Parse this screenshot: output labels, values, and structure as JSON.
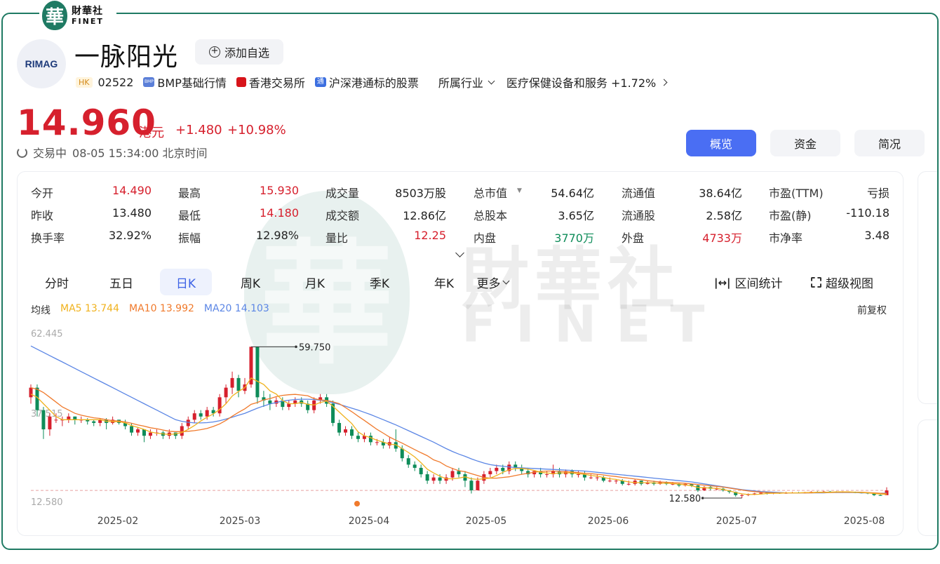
{
  "brand": {
    "cn": "財華社",
    "en": "FINET",
    "seal": "華"
  },
  "header": {
    "logo_text": "RIMAG",
    "stock_name": "一脉阳光",
    "add_watch_label": "添加自选",
    "market_tag": "HK",
    "code": "02522",
    "bmp_label": "BMP基础行情",
    "exchange": "香港交易所",
    "connect_label": "沪深港通标的股票",
    "industry_label": "所属行业",
    "industry_value": "医疗保健设备和服务 +1.72%"
  },
  "quote": {
    "price": "14.960",
    "unit": "港元",
    "change": "+1.480",
    "change_pct": "+10.98%",
    "status": "交易中",
    "time": "08-05 15:34:00 北京时间"
  },
  "tabs": [
    {
      "label": "概览",
      "active": true
    },
    {
      "label": "资金",
      "active": false
    },
    {
      "label": "简况",
      "active": false
    }
  ],
  "stats": [
    [
      {
        "label": "今开",
        "value": "14.490",
        "tone": "up"
      },
      {
        "label": "最高",
        "value": "15.930",
        "tone": "up"
      },
      {
        "label": "成交量",
        "value": "8503万股",
        "tone": ""
      },
      {
        "label": "总市值",
        "value": "54.64亿",
        "tone": "",
        "dropdown": true
      },
      {
        "label": "流通值",
        "value": "38.64亿",
        "tone": ""
      },
      {
        "label": "市盈(TTM)",
        "value": "亏损",
        "tone": ""
      }
    ],
    [
      {
        "label": "昨收",
        "value": "13.480",
        "tone": ""
      },
      {
        "label": "最低",
        "value": "14.180",
        "tone": "up"
      },
      {
        "label": "成交额",
        "value": "12.86亿",
        "tone": ""
      },
      {
        "label": "总股本",
        "value": "3.65亿",
        "tone": ""
      },
      {
        "label": "流通股",
        "value": "2.58亿",
        "tone": ""
      },
      {
        "label": "市盈(静)",
        "value": "-110.18",
        "tone": ""
      }
    ],
    [
      {
        "label": "换手率",
        "value": "32.92%",
        "tone": ""
      },
      {
        "label": "振幅",
        "value": "12.98%",
        "tone": ""
      },
      {
        "label": "量比",
        "value": "12.25",
        "tone": "up"
      },
      {
        "label": "内盘",
        "value": "3770万",
        "tone": "down"
      },
      {
        "label": "外盘",
        "value": "4733万",
        "tone": "up"
      },
      {
        "label": "市净率",
        "value": "3.48",
        "tone": ""
      }
    ]
  ],
  "period_tabs": [
    {
      "label": "分时",
      "active": false
    },
    {
      "label": "五日",
      "active": false
    },
    {
      "label": "日K",
      "active": true
    },
    {
      "label": "周K",
      "active": false
    },
    {
      "label": "月K",
      "active": false
    },
    {
      "label": "季K",
      "active": false
    },
    {
      "label": "年K",
      "active": false
    },
    {
      "label": "更多",
      "active": false
    }
  ],
  "tools": {
    "range_label": "区间统计",
    "super_view_label": "超级视图"
  },
  "legend": {
    "title": "均线",
    "ma5": "MA5 13.744",
    "ma10": "MA10 13.992",
    "ma20": "MA20 14.103",
    "adjust": "前复权"
  },
  "colors": {
    "up": "#d6202d",
    "down": "#0e8c59",
    "accent": "#4a6ef3",
    "ma5": "#f0b21e",
    "ma10": "#f07a2c",
    "ma20": "#5b86e5",
    "brand": "#1f7a63"
  },
  "chart_data": {
    "type": "candlestick",
    "y_ticks": [
      "62.445",
      "37.515",
      "12.580"
    ],
    "x_ticks": [
      "2025-02",
      "2025-03",
      "2025-04",
      "2025-05",
      "2025-06",
      "2025-07",
      "2025-08"
    ],
    "annotations": {
      "high": "59.750",
      "low": "12.580"
    },
    "ylim": [
      12.58,
      62.445
    ],
    "candles": [
      [
        44,
        47,
        42,
        48
      ],
      [
        47,
        40,
        38,
        48
      ],
      [
        40,
        34,
        31,
        41
      ],
      [
        34,
        38,
        32,
        39
      ],
      [
        37,
        37,
        36,
        39
      ],
      [
        37,
        37,
        35,
        38
      ],
      [
        37,
        38,
        36,
        39
      ],
      [
        38,
        37,
        35.5,
        38
      ],
      [
        37,
        37,
        36,
        38
      ],
      [
        37,
        36.5,
        35.5,
        37.5
      ],
      [
        36.5,
        36,
        35,
        37
      ],
      [
        36,
        37,
        35,
        37.5
      ],
      [
        37,
        36,
        34,
        37.5
      ],
      [
        36,
        37,
        35.5,
        38
      ],
      [
        37,
        36,
        35.5,
        37
      ],
      [
        36,
        35,
        34,
        37
      ],
      [
        35,
        33,
        32,
        36
      ],
      [
        33,
        34,
        32,
        34.5
      ],
      [
        34,
        32,
        30,
        34
      ],
      [
        32,
        33,
        31,
        34
      ],
      [
        33,
        33,
        32,
        34
      ],
      [
        33,
        32,
        31,
        33.5
      ],
      [
        32,
        33,
        31,
        34
      ],
      [
        33,
        32,
        31,
        33
      ],
      [
        32,
        35,
        31,
        36
      ],
      [
        35,
        37,
        34,
        38
      ],
      [
        37,
        39,
        36,
        40
      ],
      [
        39,
        38,
        37,
        40
      ],
      [
        38,
        40,
        37,
        41
      ],
      [
        40,
        39,
        38,
        41
      ],
      [
        39,
        44,
        38,
        45
      ],
      [
        44,
        47,
        42,
        48
      ],
      [
        47,
        50,
        45,
        52
      ],
      [
        50,
        46,
        44,
        51
      ],
      [
        46,
        48,
        45,
        50
      ],
      [
        48,
        59.75,
        47,
        59.75
      ],
      [
        59.75,
        44,
        42,
        59.75
      ],
      [
        44,
        43,
        41,
        46
      ],
      [
        43,
        42,
        40,
        45
      ],
      [
        42,
        43,
        41,
        44
      ],
      [
        43,
        41,
        40,
        44
      ],
      [
        41,
        42,
        40,
        43
      ],
      [
        42,
        43,
        41,
        44
      ],
      [
        43,
        42,
        41,
        44
      ],
      [
        42,
        40,
        39,
        43
      ],
      [
        40,
        43,
        39,
        44
      ],
      [
        43,
        44,
        42,
        45
      ],
      [
        44,
        42,
        41,
        45
      ],
      [
        42,
        36,
        35,
        43
      ],
      [
        36,
        33,
        32,
        37
      ],
      [
        33,
        34,
        32,
        35
      ],
      [
        34,
        32,
        31,
        35
      ],
      [
        32,
        31,
        30,
        33
      ],
      [
        31,
        32,
        30,
        33
      ],
      [
        32,
        30,
        29,
        33
      ],
      [
        30,
        30,
        29,
        31
      ],
      [
        30,
        29,
        28,
        31
      ],
      [
        29,
        30,
        28,
        31.5
      ],
      [
        30,
        28,
        27,
        34
      ],
      [
        28,
        25,
        24,
        29
      ],
      [
        25,
        23,
        22,
        26
      ],
      [
        23,
        22,
        21,
        24
      ],
      [
        22,
        20,
        19,
        23
      ],
      [
        20,
        18,
        17,
        21
      ],
      [
        18,
        19,
        17,
        20
      ],
      [
        19,
        18,
        17,
        20
      ],
      [
        18,
        19,
        17,
        20
      ],
      [
        19,
        21,
        18,
        22
      ],
      [
        21,
        20,
        19,
        22
      ],
      [
        20,
        18,
        16,
        21
      ],
      [
        18,
        15,
        14,
        19
      ],
      [
        15,
        18,
        15,
        19
      ],
      [
        18,
        20,
        17,
        21
      ],
      [
        20,
        21,
        19,
        22
      ],
      [
        21,
        22,
        20,
        23
      ],
      [
        22,
        21,
        20,
        23
      ],
      [
        21,
        23,
        20,
        24
      ],
      [
        23,
        22,
        21,
        24
      ],
      [
        22,
        21,
        20,
        23
      ],
      [
        21,
        20,
        19,
        22
      ],
      [
        20,
        21,
        19,
        21
      ],
      [
        21,
        20,
        19,
        22
      ],
      [
        20,
        20,
        19,
        21
      ],
      [
        20,
        21,
        19,
        23
      ],
      [
        21,
        20,
        19,
        22
      ],
      [
        20,
        21,
        19,
        21.5
      ],
      [
        21,
        20,
        19,
        21.5
      ],
      [
        20,
        20,
        19,
        21
      ],
      [
        20,
        19,
        18,
        21
      ],
      [
        19,
        19,
        18.5,
        20
      ],
      [
        19,
        19,
        18,
        20
      ],
      [
        19,
        18,
        17.5,
        19.5
      ],
      [
        18,
        18,
        17.5,
        19
      ],
      [
        18,
        18,
        17,
        18.5
      ],
      [
        18,
        17,
        16.5,
        18.5
      ],
      [
        17,
        17,
        16.5,
        18
      ],
      [
        17,
        18,
        16.5,
        18.5
      ],
      [
        18,
        17,
        16.5,
        18
      ],
      [
        17,
        17.5,
        16.8,
        18
      ],
      [
        17.5,
        17,
        16.5,
        18
      ],
      [
        17,
        17.5,
        16.7,
        18
      ],
      [
        17.5,
        17,
        16.6,
        17.8
      ],
      [
        17,
        17,
        16.6,
        17.6
      ],
      [
        17,
        16.5,
        16,
        17.3
      ],
      [
        16.5,
        17,
        16.2,
        17.2
      ],
      [
        17,
        16.5,
        16,
        17
      ],
      [
        16.5,
        15,
        14.5,
        16.8
      ],
      [
        15,
        16,
        14.8,
        16.3
      ],
      [
        16,
        15.5,
        15,
        16.3
      ],
      [
        15.5,
        15.5,
        15,
        16
      ],
      [
        15.5,
        15,
        14.6,
        15.8
      ],
      [
        15,
        14.5,
        14,
        15
      ],
      [
        14.5,
        13.5,
        13,
        14.6
      ],
      [
        13.5,
        13.5,
        12.58,
        14
      ],
      [
        13.5,
        13.8,
        13.2,
        14
      ],
      [
        13.8,
        14,
        13.5,
        14.2
      ],
      [
        14,
        14.2,
        13.8,
        14.4
      ],
      [
        14.2,
        14,
        13.7,
        14.4
      ],
      [
        14,
        14.2,
        13.8,
        14.4
      ],
      [
        14.2,
        14.1,
        13.9,
        14.4
      ],
      [
        14.1,
        14.2,
        13.9,
        14.5
      ],
      [
        14.2,
        14.3,
        14,
        14.5
      ],
      [
        14.3,
        14.2,
        14,
        14.5
      ],
      [
        14.2,
        14.3,
        14,
        14.5
      ],
      [
        14.3,
        14.5,
        14.1,
        14.7
      ],
      [
        14.5,
        14.4,
        14.2,
        14.7
      ],
      [
        14.4,
        14.6,
        14.2,
        14.8
      ],
      [
        14.6,
        14.5,
        14.3,
        14.8
      ],
      [
        14.5,
        14.4,
        14.2,
        14.7
      ],
      [
        14.4,
        14.5,
        14.2,
        14.7
      ],
      [
        14.5,
        14.4,
        14.2,
        14.6
      ],
      [
        14.4,
        14.3,
        14.1,
        14.6
      ],
      [
        14.3,
        14.2,
        14,
        14.5
      ],
      [
        14.2,
        14,
        13.8,
        14.4
      ],
      [
        14,
        13.5,
        13.2,
        14.2
      ],
      [
        13.5,
        13.48,
        13.3,
        13.8
      ],
      [
        13.48,
        14.96,
        14.18,
        15.93
      ]
    ],
    "ma5": [
      45,
      44,
      42,
      40,
      38,
      37,
      37,
      37,
      37,
      37,
      37,
      37,
      36.5,
      36.4,
      36.4,
      36,
      35.2,
      34.6,
      34,
      33.2,
      32.8,
      32.6,
      32.4,
      32.6,
      33,
      34,
      35.2,
      36.6,
      37.8,
      38.8,
      40.2,
      42,
      44.4,
      45.8,
      47,
      50,
      49,
      48,
      46,
      45,
      43,
      42,
      42,
      42.4,
      41.8,
      41.6,
      42.4,
      42.8,
      41.2,
      39.4,
      37.6,
      35.8,
      33.2,
      32,
      31.4,
      30.6,
      30,
      29.4,
      29.2,
      28,
      26.8,
      25.4,
      23.6,
      21.6,
      20.4,
      19.4,
      18.6,
      18.6,
      18.8,
      19.2,
      18.6,
      18.4,
      18.6,
      18.8,
      19.6,
      20.6,
      21.4,
      21.8,
      21.8,
      21.6,
      21.2,
      20.6,
      20.4,
      20.2,
      20.4,
      20.4,
      20.4,
      20.2,
      20,
      19.6,
      19.4,
      19,
      18.6,
      18.4,
      18,
      17.6,
      17.4,
      17.4,
      17.4,
      17.3,
      17.2,
      17.2,
      17.1,
      16.9,
      16.7,
      16.4,
      15.9,
      15.8,
      15.7,
      15.6,
      15.3,
      14.8,
      14.3,
      13.9,
      13.7,
      13.7,
      13.8,
      14,
      14.1,
      14.1,
      14.2,
      14.2,
      14.2,
      14.3,
      14.3,
      14.4,
      14.4,
      14.4,
      14.5,
      14.5,
      14.5,
      14.4,
      14.3,
      14.2,
      14,
      13.8,
      13.74
    ],
    "ma10": [
      47,
      46.5,
      45.5,
      44,
      42.5,
      41,
      40,
      39,
      38.4,
      38,
      37.6,
      37.4,
      37,
      36.7,
      36.6,
      36.3,
      35.9,
      35.4,
      35,
      34.5,
      34.2,
      33.8,
      33.4,
      33.3,
      33.3,
      33.4,
      33.6,
      33.9,
      34.3,
      34.9,
      35.7,
      36.8,
      38.1,
      39.3,
      40.4,
      41.8,
      42.4,
      43.2,
      43.6,
      44.2,
      44.6,
      44.8,
      44.9,
      44.7,
      44.5,
      43.6,
      43.2,
      43,
      42.6,
      42,
      40.8,
      39.5,
      38.1,
      36.8,
      35.4,
      34,
      32.8,
      31.6,
      30.6,
      29.7,
      28.7,
      27.7,
      26.7,
      25.8,
      24.5,
      23.8,
      22.6,
      21.8,
      21.1,
      20.8,
      20.2,
      19.6,
      19,
      18.8,
      18.8,
      19,
      19.2,
      19.6,
      20,
      20.3,
      20.6,
      20.9,
      21,
      21,
      20.9,
      20.8,
      20.7,
      20.5,
      20.3,
      20.2,
      20,
      19.8,
      19.5,
      19.3,
      19,
      18.8,
      18.5,
      18.3,
      18,
      17.8,
      17.6,
      17.5,
      17.4,
      17.3,
      17.2,
      17,
      16.8,
      16.6,
      16.4,
      16.2,
      16,
      15.7,
      15.4,
      15.1,
      14.8,
      14.6,
      14.4,
      14.3,
      14.2,
      14.2,
      14.2,
      14.2,
      14.2,
      14.2,
      14.2,
      14.3,
      14.3,
      14.3,
      14.4,
      14.4,
      14.4,
      14.4,
      14.4,
      14.3,
      14.2,
      14.1,
      13.99
    ],
    "ma20": [
      60,
      59,
      58,
      57,
      56,
      55,
      54,
      53,
      52,
      51,
      50,
      49,
      48,
      47,
      46,
      45,
      44,
      43,
      42,
      41,
      40,
      39,
      38,
      37,
      36.5,
      36.2,
      36,
      36,
      36.1,
      36.3,
      36.7,
      37.2,
      37.8,
      38.4,
      39,
      39.8,
      40.6,
      41.3,
      41.9,
      42.4,
      42.8,
      43.1,
      43.3,
      43.4,
      43.4,
      43.3,
      43.1,
      42.8,
      42.3,
      41.8,
      41.2,
      40.6,
      40,
      39.3,
      38.6,
      37.8,
      37,
      36.2,
      35.4,
      34.5,
      33.6,
      32.7,
      31.8,
      30.9,
      30,
      29,
      28,
      27.1,
      26.3,
      25.6,
      24.8,
      24.1,
      23.5,
      23,
      22.7,
      22.5,
      22.3,
      22.1,
      22,
      21.9,
      21.8,
      21.7,
      21.6,
      21.5,
      21.4,
      21.3,
      21.2,
      21.1,
      21,
      20.8,
      20.6,
      20.4,
      20.2,
      20,
      19.8,
      19.6,
      19.4,
      19.2,
      19,
      18.8,
      18.6,
      18.4,
      18.2,
      18,
      17.8,
      17.6,
      17.3,
      17,
      16.7,
      16.4,
      16.1,
      15.8,
      15.5,
      15.2,
      15,
      14.8,
      14.6,
      14.5,
      14.4,
      14.3,
      14.2,
      14.2,
      14.2,
      14.2,
      14.2,
      14.2,
      14.2,
      14.3,
      14.3,
      14.3,
      14.3,
      14.3,
      14.2,
      14.2,
      14.1,
      14.1,
      14.103
    ]
  }
}
